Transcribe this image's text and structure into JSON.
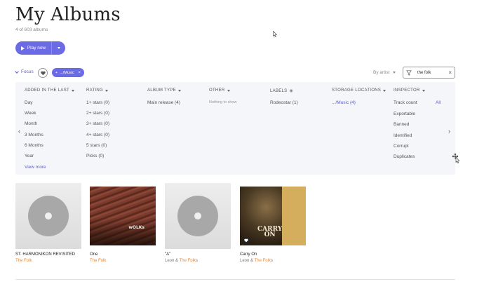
{
  "header": {
    "title": "My Albums",
    "subtitle": "4 of 603 albums"
  },
  "toolbar": {
    "play_label": "Play now"
  },
  "filters": {
    "focus_label": "Focus",
    "chip_label": ".../Music",
    "chip_remove": "×"
  },
  "sort": {
    "label": "By artist"
  },
  "search": {
    "value": "the folk",
    "clear": "×"
  },
  "columns": {
    "added": {
      "title": "ADDED IN THE LAST",
      "items": [
        "Day",
        "Week",
        "Month",
        "3 Months",
        "6 Months",
        "Year"
      ]
    },
    "rating": {
      "title": "RATING",
      "items": [
        "1+ stars (0)",
        "2+ stars (0)",
        "3+ stars (0)",
        "4+ stars (0)",
        "5 stars (0)",
        "Picks (0)"
      ]
    },
    "album_type": {
      "title": "ALBUM TYPE",
      "items": [
        "Main release (4)"
      ]
    },
    "other": {
      "title": "OTHER",
      "items": [
        "Nothing to show"
      ]
    },
    "labels": {
      "title": "LABELS",
      "items": [
        "Rodeostar (1)"
      ]
    },
    "storage": {
      "title": "STORAGE LOCATIONS",
      "items": [
        ".../Music (4)"
      ]
    },
    "inspector": {
      "title": "INSPECTOR",
      "items": [
        "Track count",
        "Exportable",
        "Banned",
        "Identified",
        "Corrupt",
        "Duplicates"
      ],
      "all_label": "All"
    },
    "view_more": "View more"
  },
  "albums": [
    {
      "title": "ST. HARMONIKON REVISITED",
      "artist_prefix": "",
      "artist_hl": "The Folk",
      "artist_suffix": ""
    },
    {
      "title": "One",
      "artist_prefix": "",
      "artist_hl": "The Folk",
      "artist_suffix": ""
    },
    {
      "title": "\"A\"",
      "artist_prefix": "Leon & ",
      "artist_hl": "The Folk",
      "artist_suffix": "s"
    },
    {
      "title": "Carry On",
      "artist_prefix": "Leon & ",
      "artist_hl": "The Folk",
      "artist_suffix": "s"
    }
  ],
  "art_text": {
    "one": "wOLKs",
    "carry_line1": "CARRY",
    "carry_line2": "ON"
  },
  "colors": {
    "accent": "#6b6be6",
    "highlight": "#e6893b",
    "panel_bg": "#f4f6f9"
  }
}
